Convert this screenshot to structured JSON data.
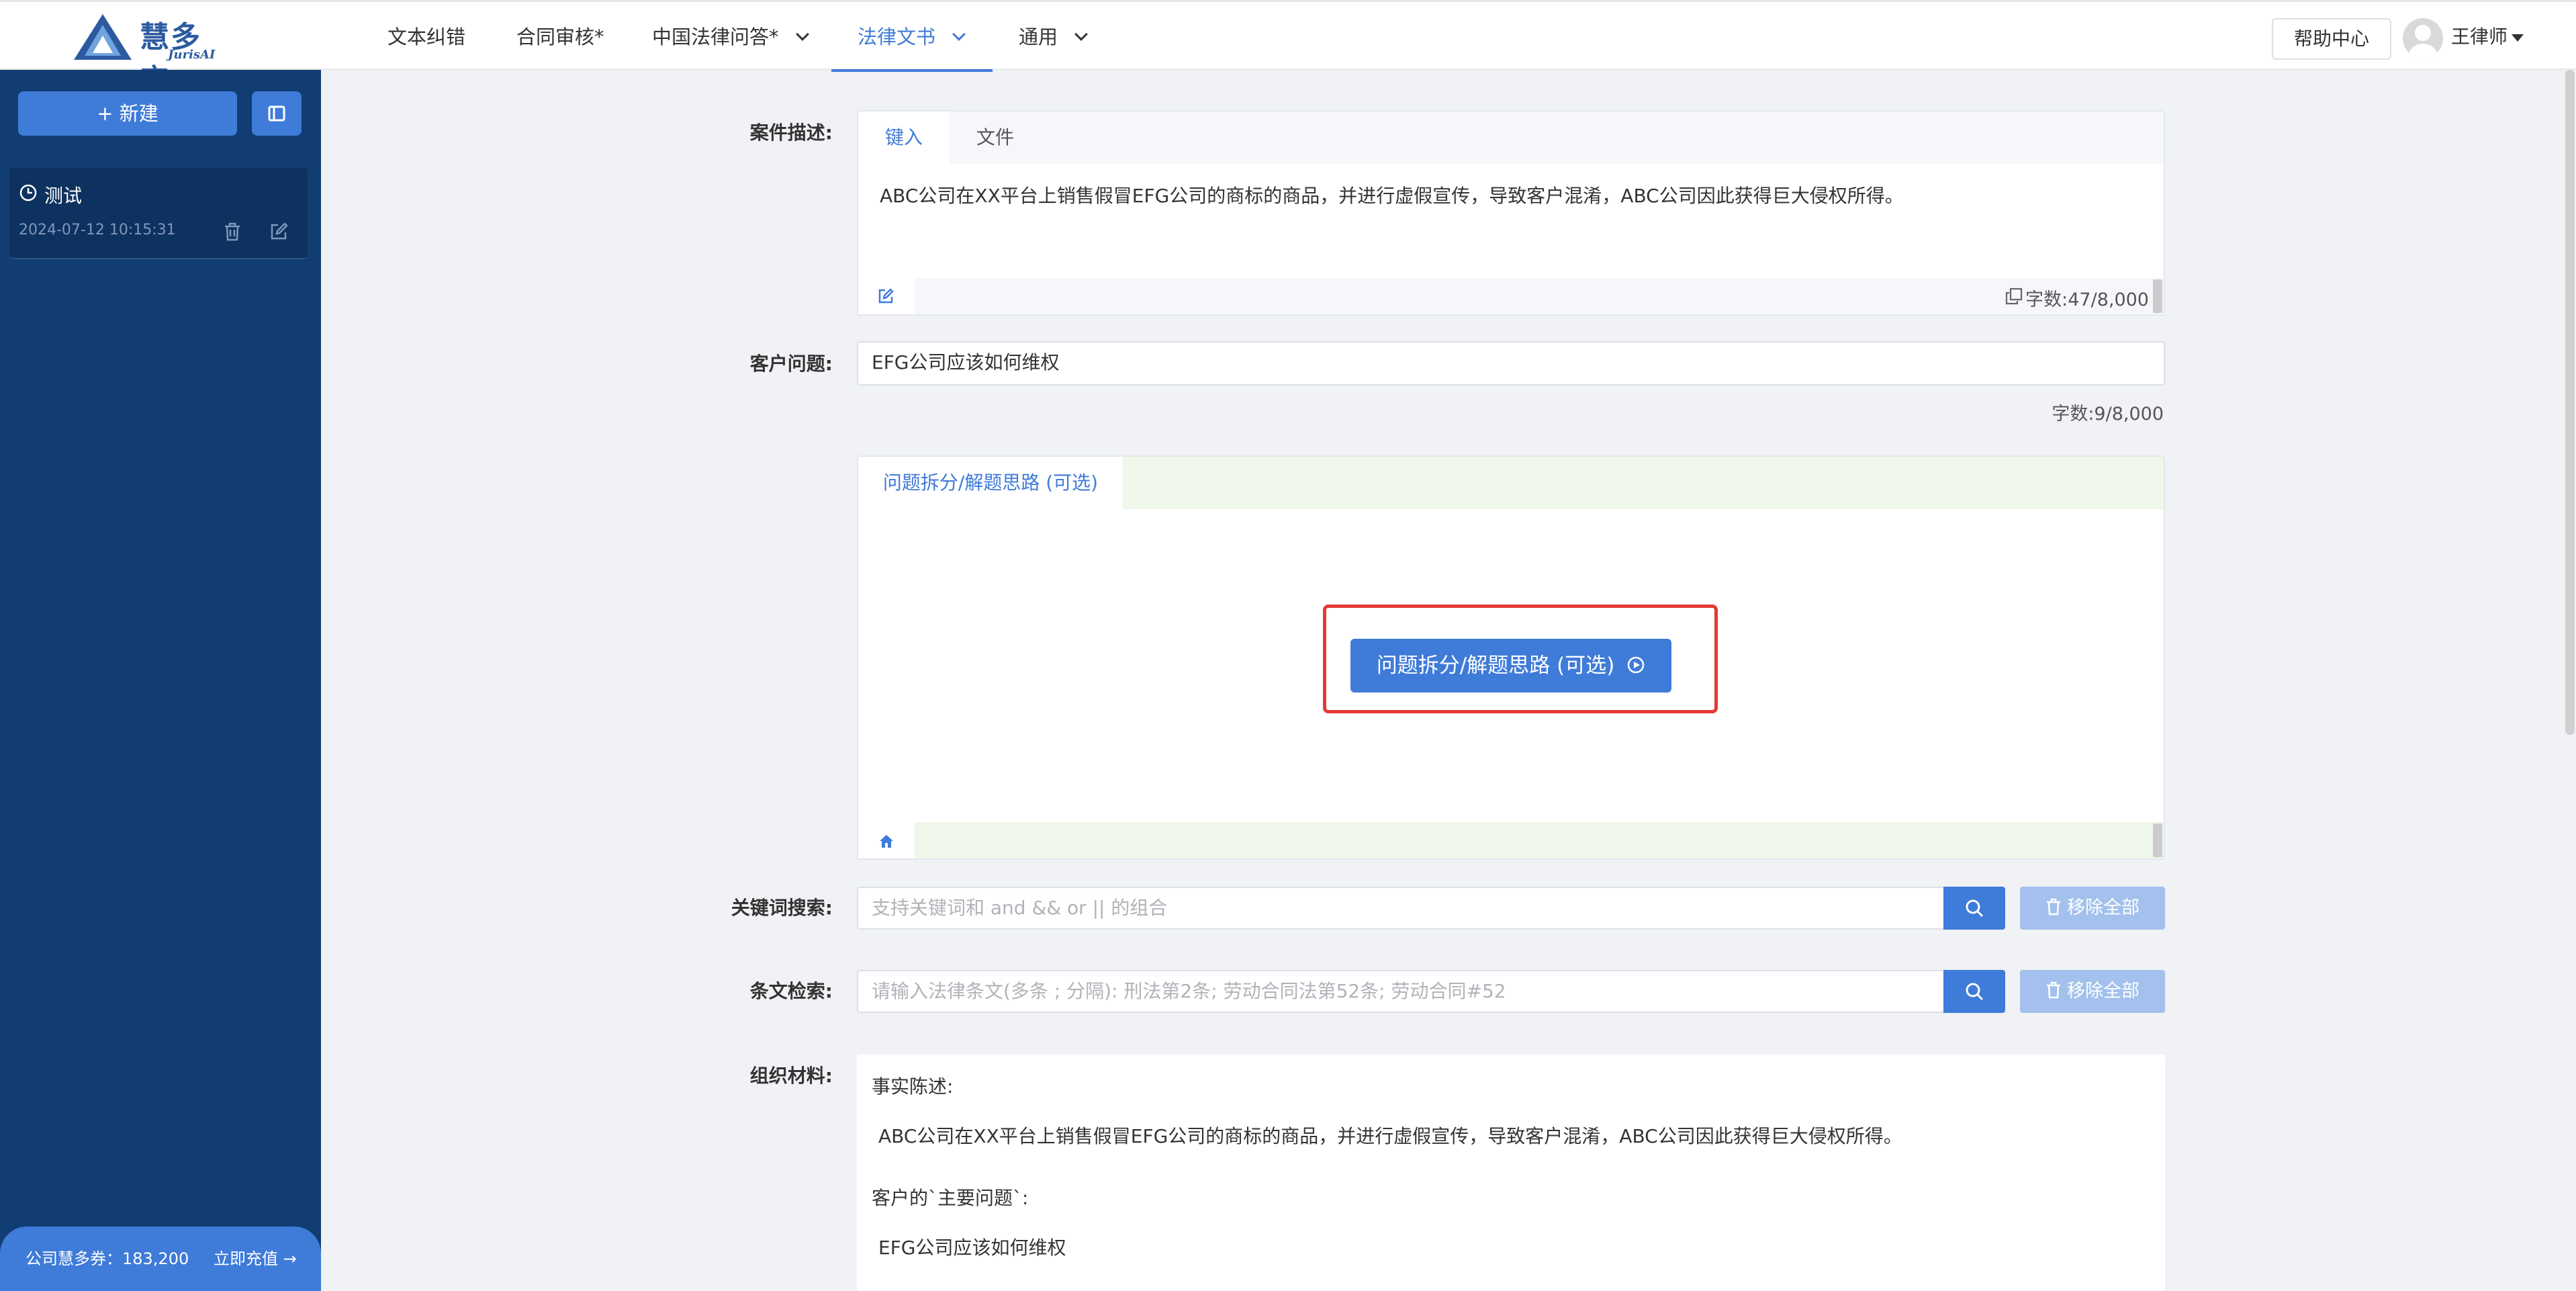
{
  "header": {
    "logo_text": "慧多宝",
    "logo_sub": "JurisAI",
    "nav": [
      {
        "label": "文本纠错"
      },
      {
        "label": "合同审核*"
      },
      {
        "label": "中国法律问答*"
      },
      {
        "label": "法律文书"
      },
      {
        "label": "通用"
      }
    ],
    "active_nav": "法律文书",
    "help": "帮助中心",
    "user": "王律师"
  },
  "sidebar": {
    "new_label": "+ 新建",
    "session": {
      "title": "测试",
      "datetime": "2024-07-12 10:15:31"
    },
    "balance": "公司慧多券：183,200",
    "recharge": "立即充值"
  },
  "form": {
    "case_label": "案件描述:",
    "case_tabs": [
      "键入",
      "文件"
    ],
    "case_text": "ABC公司在XX平台上销售假冒EFG公司的商标的商品，并进行虚假宣传，导致客户混淆，ABC公司因此获得巨大侵权所得。",
    "case_count": "字数:47/8,000",
    "question_label": "客户问题:",
    "question_text": "EFG公司应该如何维权",
    "question_count": "字数:9/8,000",
    "analysis_tab": "问题拆分/解题思路 (可选)",
    "analysis_button": "问题拆分/解题思路 (可选)",
    "keyword_label": "关键词搜索:",
    "keyword_placeholder": "支持关键词和 and && or || 的组合",
    "keyword_remove": "移除全部",
    "article_label": "条文检索:",
    "article_placeholder": "请输入法律条文(多条 ; 分隔): 刑法第2条; 劳动合同法第52条; 劳动合同#52",
    "article_remove": "移除全部",
    "org_label": "组织材料:",
    "org_lines": [
      "事实陈述:",
      "ABC公司在XX平台上销售假冒EFG公司的商标的商品，并进行虚假宣传，导致客户混淆，ABC公司因此获得巨大侵权所得。",
      "客户的`主要问题`:",
      "EFG公司应该如何维权"
    ]
  },
  "colors": {
    "primary": "#3f7bd8",
    "sidebar": "#123d73",
    "highlight": "#e53935",
    "light_blue": "#a3c1ec"
  }
}
